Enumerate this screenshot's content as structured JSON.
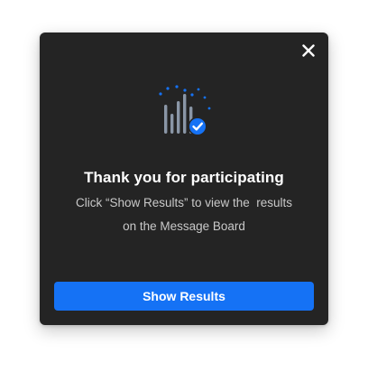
{
  "dialog": {
    "title": "Thank you for participating",
    "message_line_1": "Click “Show Results” to view the  results",
    "message_line_2": "on the Message Board",
    "primary_button_label": "Show Results",
    "close_icon": "close-icon",
    "illustration_icon": "poll-results-check-icon"
  },
  "colors": {
    "dialog_background": "#242424",
    "accent": "#1572f5",
    "bars": "#8a96a6",
    "title_text": "#ffffff",
    "body_text": "#c9c9c9"
  }
}
